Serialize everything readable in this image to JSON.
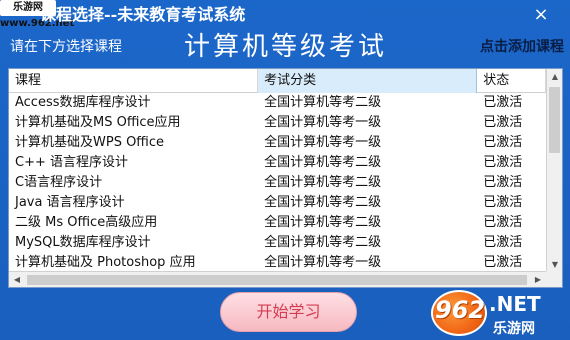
{
  "watermark": "乐游网 www.962.net",
  "window": {
    "title": "课程选择--未来教育考试系统",
    "close_icon": "×"
  },
  "header": {
    "subtitle": "请在下方选择课程",
    "main_title": "计算机等级考试",
    "add_course": "点击添加课程"
  },
  "table": {
    "columns": [
      "课程",
      "考试分类",
      "状态"
    ],
    "rows": [
      [
        "Access数据库程序设计",
        "全国计算机等考二级",
        "已激活"
      ],
      [
        "计算机基础及MS Office应用",
        "全国计算机等考一级",
        "已激活"
      ],
      [
        "计算机基础及WPS Office",
        "全国计算机等考一级",
        "已激活"
      ],
      [
        "C++ 语言程序设计",
        "全国计算机等考二级",
        "已激活"
      ],
      [
        "C语言程序设计",
        "全国计算机等考二级",
        "已激活"
      ],
      [
        "Java 语言程序设计",
        "全国计算机等考二级",
        "已激活"
      ],
      [
        "二级 Ms Office高级应用",
        "全国计算机等考二级",
        "已激活"
      ],
      [
        "MySQL数据库程序设计",
        "全国计算机等考二级",
        "已激活"
      ],
      [
        "计算机基础及 Photoshop 应用",
        "全国计算机等考一级",
        "已激活"
      ]
    ]
  },
  "buttons": {
    "start": "开始学习"
  },
  "brand": {
    "logo": "962",
    "net": ".NET",
    "cn": "乐游网"
  },
  "colors": {
    "background": "#1a62c2",
    "start_button": "#f6b9c1",
    "start_text": "#d43c53",
    "selected_header": "#d9ecfb"
  }
}
